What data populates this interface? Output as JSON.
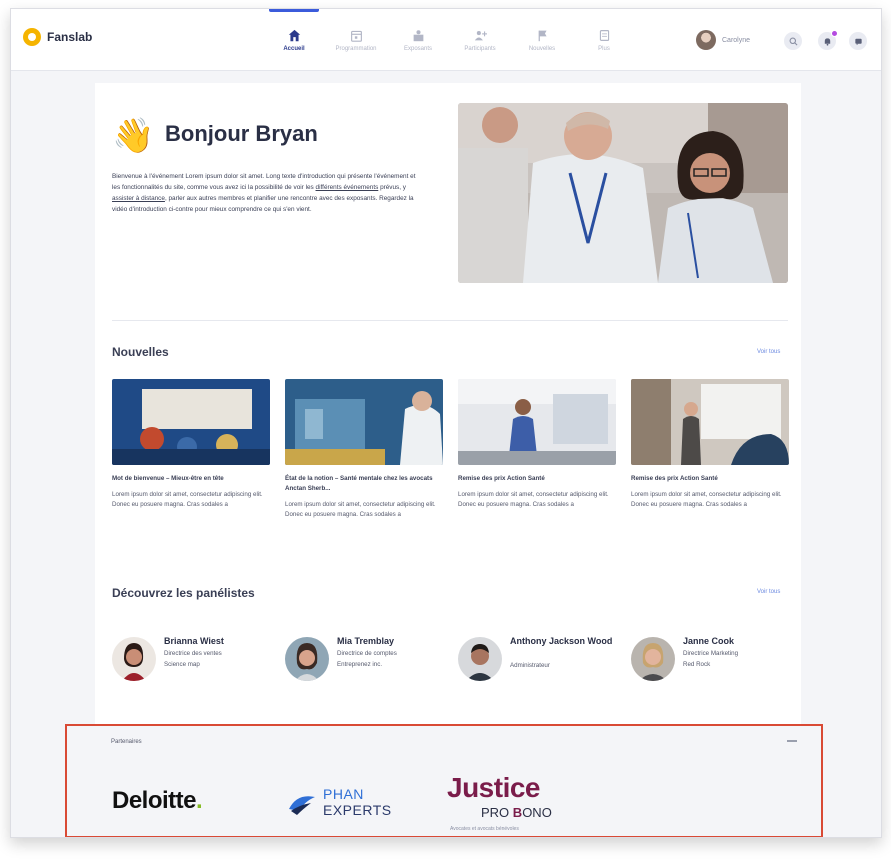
{
  "app": {
    "name": "Fanslab"
  },
  "nav": {
    "items": [
      {
        "label": "Accueil",
        "icon": "home-icon",
        "active": true
      },
      {
        "label": "Programmation",
        "icon": "calendar-icon"
      },
      {
        "label": "Exposants",
        "icon": "booth-icon"
      },
      {
        "label": "Participants",
        "icon": "people-icon"
      },
      {
        "label": "Nouvelles",
        "icon": "flag-icon"
      },
      {
        "label": "Plus",
        "icon": "more-icon"
      }
    ]
  },
  "user": {
    "name": "Carolyne",
    "notification_color": "#b44be0"
  },
  "welcome": {
    "greeting": "Bonjour Bryan",
    "intro_part1": "Bienvenue à l'événement Lorem ipsum dolor sit amet. Long texte d'introduction qui présente l'événement et les fonctionnalités du site, comme vous avez ici la possibilité de voir les ",
    "intro_link1": "différents événements",
    "intro_part2": " prévus, y ",
    "intro_link2": "assister à distance",
    "intro_part3": ", parler aux autres membres et planifier une rencontre avec des exposants. Regardez la vidéo d'introduction ci-contre pour mieux comprendre ce qui s'en vient."
  },
  "news": {
    "title": "Nouvelles",
    "see_all": "Voir tous",
    "items": [
      {
        "title": "Mot de bienvenue – Mieux-être en tête",
        "text": "Lorem ipsum dolor sit amet, consectetur adipiscing elit. Donec eu posuere magna. Cras sodales a"
      },
      {
        "title": "État de la notion – Santé mentale chez les avocats Anctan Sherb...",
        "text": "Lorem ipsum dolor sit amet, consectetur adipiscing elit. Donec eu posuere magna. Cras sodales a"
      },
      {
        "title": "Remise des prix Action Santé",
        "text": "Lorem ipsum dolor sit amet, consectetur adipiscing elit. Donec eu posuere magna. Cras sodales a"
      },
      {
        "title": "Remise des prix Action Santé",
        "text": "Lorem ipsum dolor sit amet, consectetur adipiscing elit. Donec eu posuere magna. Cras sodales a"
      }
    ]
  },
  "panelists": {
    "title": "Découvrez les panélistes",
    "see_all": "Voir tous",
    "items": [
      {
        "name": "Brianna Wiest",
        "role": "Directrice des ventes",
        "company": "Science map"
      },
      {
        "name": "Mia Tremblay",
        "role": "Directrice de comptes",
        "company": "Entreprenez inc."
      },
      {
        "name": "Anthony Jackson Wood",
        "role": "Administrateur",
        "company": ""
      },
      {
        "name": "Janne Cook",
        "role": "Directrice Marketing",
        "company": "Red Rock"
      }
    ]
  },
  "partners": {
    "label": "Partenaires",
    "deloitte": "Deloitte",
    "deloitte_dot": ".",
    "phan_line1": "PHAN",
    "phan_line2": "EXPERTS",
    "justice": "Justice",
    "probono_1": "PRO ",
    "probono_b": "B",
    "probono_2": "ONO",
    "justice_sub": "Avocates et avocats bénévoles"
  }
}
